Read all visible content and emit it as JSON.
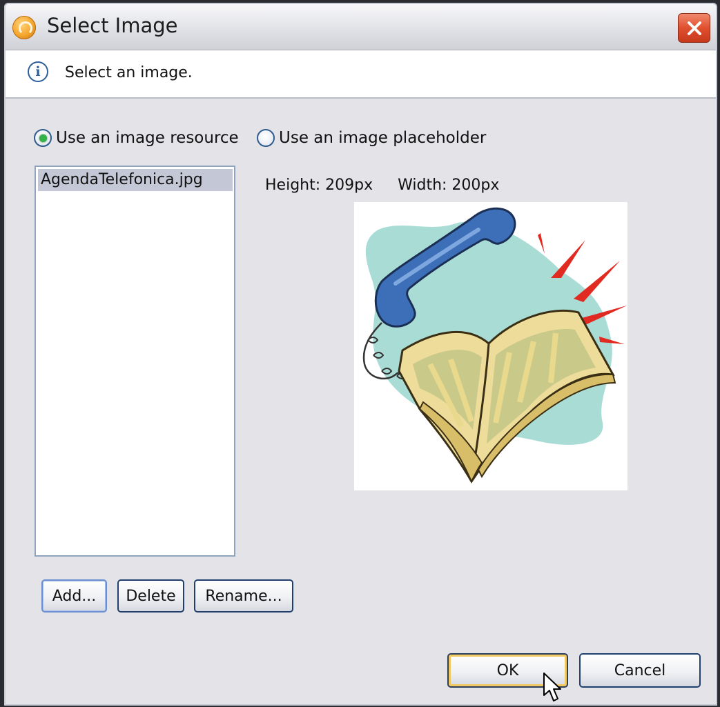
{
  "window": {
    "title": "Select Image",
    "app_icon": "app-logo-icon",
    "close_icon": "close-icon"
  },
  "banner": {
    "icon": "info-icon",
    "icon_glyph": "i",
    "message": "Select an image."
  },
  "source_options": [
    {
      "label": "Use an image resource",
      "selected": true
    },
    {
      "label": "Use an image placeholder",
      "selected": false
    }
  ],
  "resources": {
    "items": [
      "AgendaTelefonica.jpg"
    ],
    "selected_index": 0
  },
  "preview": {
    "height_label": "Height: 209px",
    "width_label": "Width: 200px",
    "image": "telephone-book-clipart"
  },
  "list_buttons": {
    "add": "Add...",
    "delete": "Delete",
    "rename": "Rename..."
  },
  "dialog_buttons": {
    "ok": "OK",
    "cancel": "Cancel"
  },
  "colors": {
    "radio_selected": "#34b24a",
    "list_selection": "#c4c8d6",
    "default_button_glow": "#f2c860",
    "close_button": "#e0502f"
  }
}
